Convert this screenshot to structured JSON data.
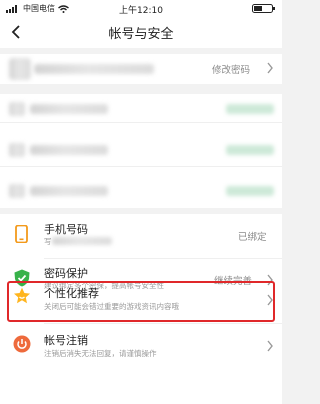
{
  "status_bar": {
    "carrier": "中国电信",
    "time": "上午12:10"
  },
  "header": {
    "title": "帐号与安全"
  },
  "profile": {
    "action": "修改密码"
  },
  "rows": {
    "phone": {
      "label": "手机号码",
      "sub": "写",
      "value": "已绑定"
    },
    "password": {
      "label": "密码保护",
      "sub": "建议绑定多个密保，提高帐号安全性",
      "value": "继续完善"
    },
    "personalized": {
      "label": "个性化推荐",
      "sub": "关闭后可能会错过重要的游戏资讯内容哦"
    },
    "cancel": {
      "label": "帐号注销",
      "sub": "注销后消失无法回复，请谨慎操作"
    }
  },
  "colors": {
    "highlight": "#e0282a",
    "phone_icon": "#f39a1c",
    "shield_icon": "#38b24a",
    "star_icon": "#ffb51e",
    "cancel_icon": "#ee6a3c"
  }
}
